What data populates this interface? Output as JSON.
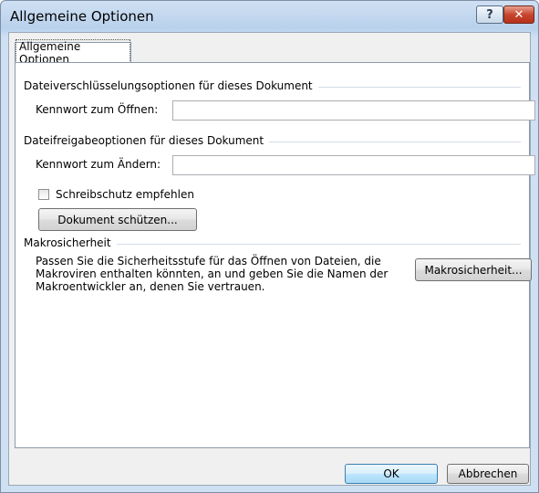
{
  "window": {
    "title": "Allgemeine Optionen",
    "help_label": "?",
    "close_label": "✕"
  },
  "tab": {
    "label": "Allgemeine Optionen"
  },
  "encryption": {
    "group_label": "Dateiverschlüsselungsoptionen für dieses Dokument",
    "open_password_label": "Kennwort zum Öffnen:",
    "open_password_value": ""
  },
  "sharing": {
    "group_label": "Dateifreigabeoptionen für dieses Dokument",
    "modify_password_label": "Kennwort zum Ändern:",
    "modify_password_value": "",
    "readonly_label": "Schreibschutz empfehlen",
    "readonly_checked": false,
    "protect_button": "Dokument schützen..."
  },
  "macro": {
    "group_label": "Makrosicherheit",
    "description": "Passen Sie die Sicherheitsstufe für das Öffnen von Dateien, die Makroviren enthalten könnten, an und geben Sie die Namen der Makroentwickler an, denen Sie vertrauen.",
    "button": "Makrosicherheit..."
  },
  "footer": {
    "ok": "OK",
    "cancel": "Abbrechen"
  }
}
